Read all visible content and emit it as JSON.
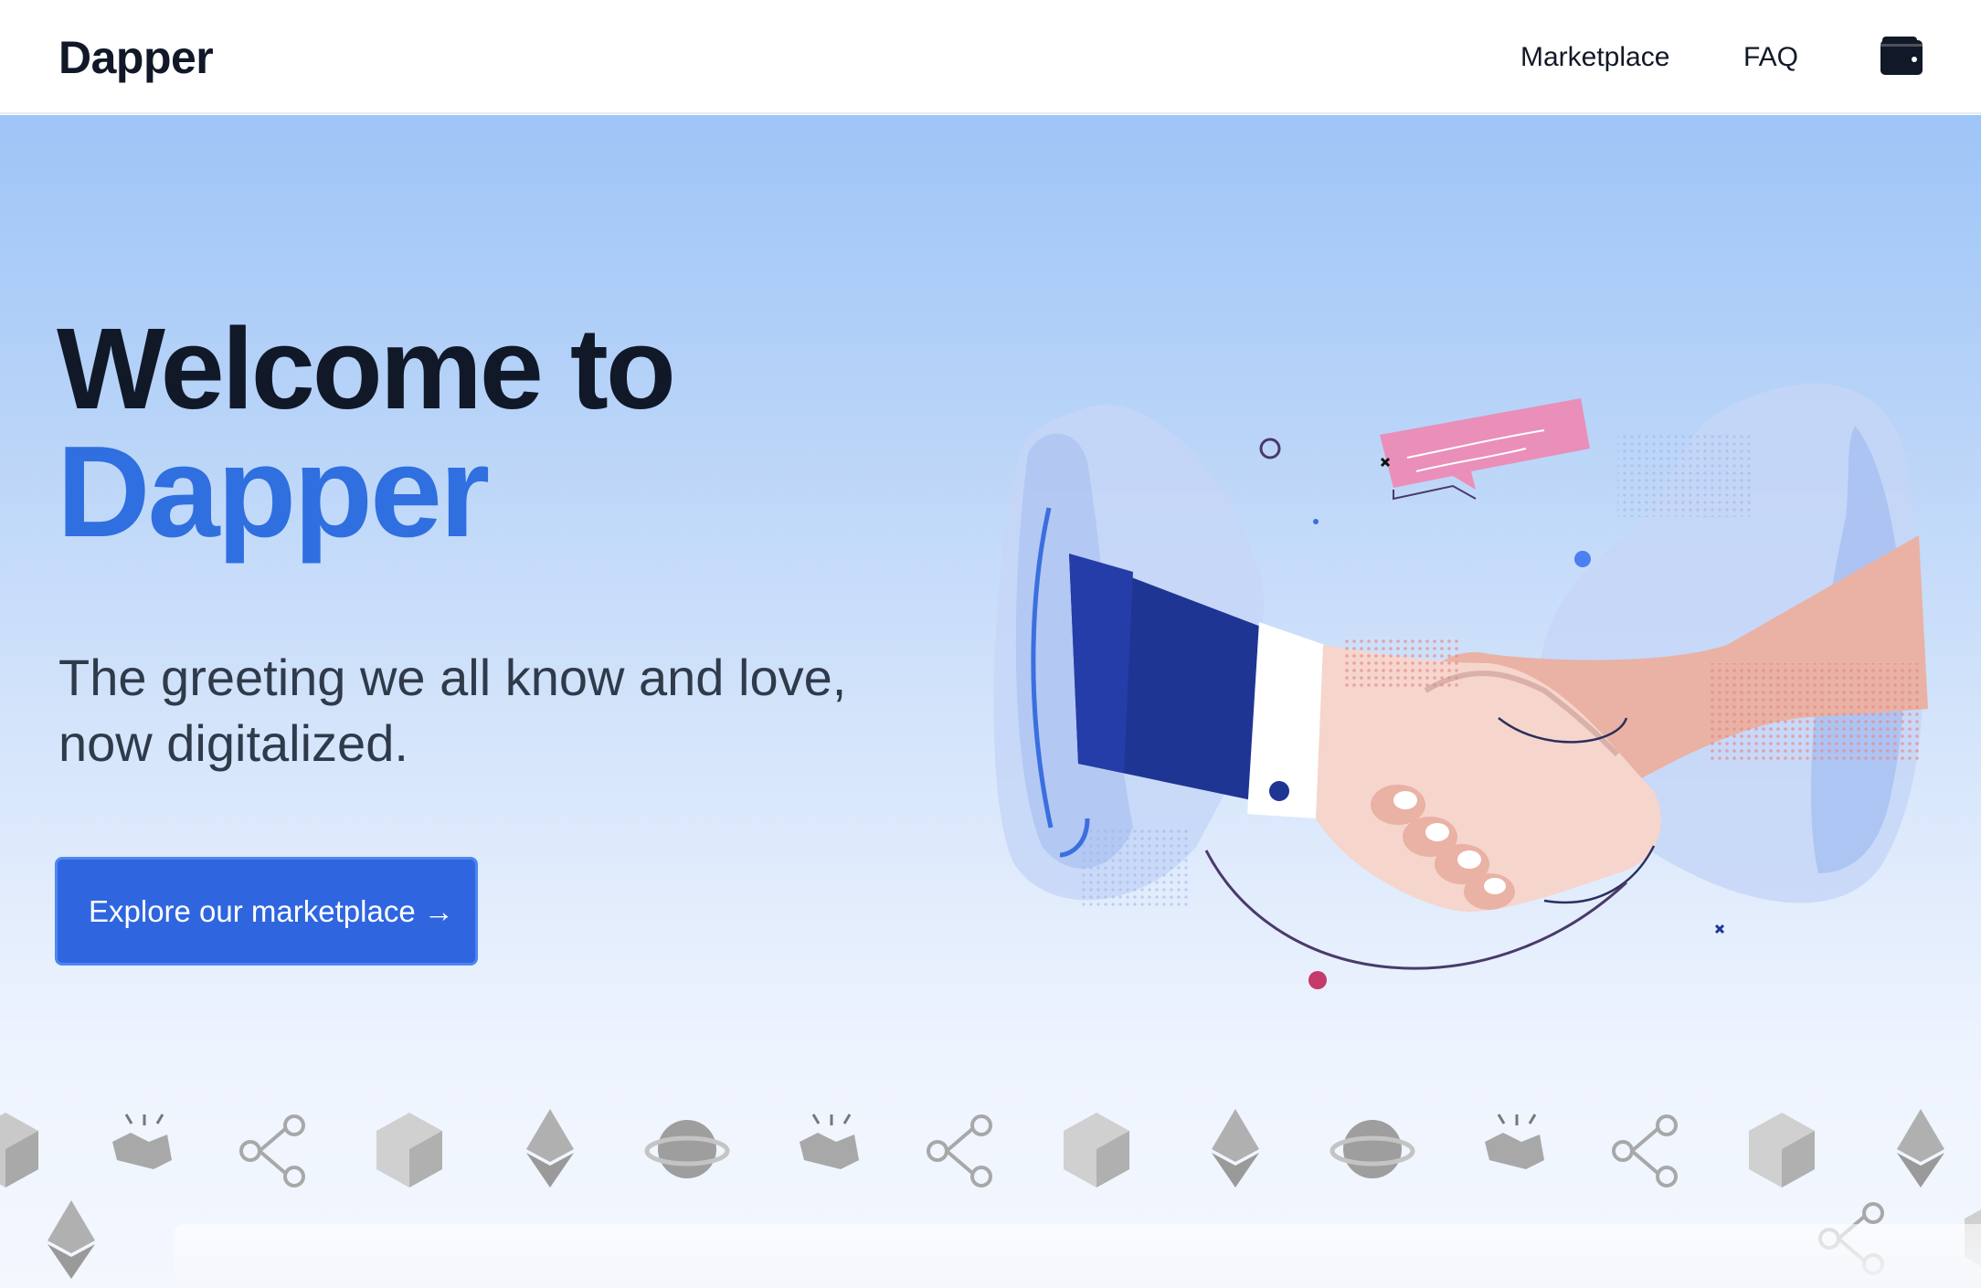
{
  "navbar": {
    "brand": "Dapper",
    "links": [
      {
        "label": "Marketplace"
      },
      {
        "label": "FAQ"
      }
    ],
    "wallet_icon": "wallet-icon"
  },
  "hero": {
    "title_line1": "Welcome to",
    "title_line2": "Dapper",
    "subtitle": "The greeting we all know and love, now digitalized.",
    "cta_label": "Explore our marketplace →",
    "illustration": "handshake-illustration"
  },
  "colors": {
    "accent": "#2f66df",
    "title_accent": "#2f6fe0",
    "text_dark": "#111827",
    "hero_top": "#9ec5f7",
    "hero_bottom": "#f3f7fe"
  },
  "icon_strip": [
    "cube-icon",
    "handshake-icon",
    "share-nodes-icon",
    "cube-icon",
    "ethereum-icon",
    "planet-icon",
    "handshake-icon",
    "share-nodes-icon",
    "cube-icon",
    "ethereum-icon",
    "planet-icon",
    "handshake-icon",
    "share-nodes-icon",
    "cube-icon",
    "ethereum-icon"
  ]
}
